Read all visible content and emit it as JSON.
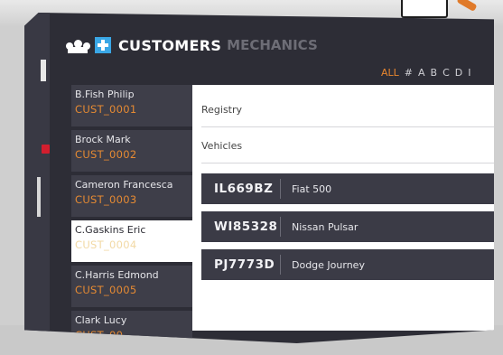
{
  "header": {
    "tab_customers": "CUSTOMERS",
    "tab_mechanics": "MECHANICS"
  },
  "filter": {
    "letters": [
      "ALL",
      "#",
      "A",
      "B",
      "C",
      "D",
      "I"
    ],
    "active": "ALL"
  },
  "customers": [
    {
      "name": "B.Fish Philip",
      "id": "CUST_0001"
    },
    {
      "name": "Brock Mark",
      "id": "CUST_0002"
    },
    {
      "name": "Cameron Francesca",
      "id": "CUST_0003"
    },
    {
      "name": "C.Gaskins Eric",
      "id": "CUST_0004"
    },
    {
      "name": "C.Harris Edmond",
      "id": "CUST_0005"
    },
    {
      "name": "Clark Lucy",
      "id": "CUST_00"
    }
  ],
  "selected_index": 3,
  "detail": {
    "registry_label": "Registry",
    "vehicles_label": "Vehicles",
    "vehicles": [
      {
        "plate": "IL669BZ",
        "model": "Fiat 500"
      },
      {
        "plate": "WI85328",
        "model": "Nissan Pulsar"
      },
      {
        "plate": "PJ7773D",
        "model": "Dodge Journey"
      }
    ]
  },
  "colors": {
    "accent": "#e8862e",
    "panel": "#2d2d36",
    "medical": "#3aa7e6"
  }
}
